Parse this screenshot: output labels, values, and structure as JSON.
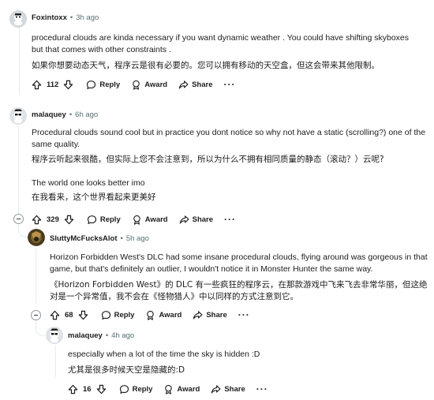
{
  "comments": [
    {
      "username": "Foxintoxx",
      "time": "3h ago",
      "paragraphs": [
        "procedural clouds are kinda necessary if you want dynamic weather . You could have shifting skyboxes but that comes with other constraints .",
        "如果你想要动态天气，程序云是很有必要的。您可以拥有移动的天空盒，但这会带来其他限制。"
      ],
      "score": "112",
      "reply": "Reply",
      "award": "Award",
      "share": "Share"
    },
    {
      "username": "malaquey",
      "time": "6h ago",
      "paragraphs": [
        "Procedural clouds sound cool but in practice you dont notice so why not have a static (scrolling?) one of the same quality.",
        "程序云听起来很酷，但实际上您不会注意到，所以为什么不拥有相同质量的静态（滚动？）云呢?",
        "The world one looks better imo",
        "在我看来，这个世界看起来更美好"
      ],
      "score": "329",
      "reply": "Reply",
      "award": "Award",
      "share": "Share"
    },
    {
      "username": "SluttyMcFucksAlot",
      "time": "5h ago",
      "paragraphs": [
        "Horizon Forbidden West's DLC had some insane procedural clouds, flying around was gorgeous in that game, but that's definitely an outlier, I wouldn't notice it in Monster Hunter the same way.",
        "《Horizon Forbidden West》的 DLC 有一些疯狂的程序云，在那款游戏中飞来飞去非常华丽，但这绝对是一个异常值，我不会在《怪物猎人》中以同样的方式注意到它。"
      ],
      "score": "68",
      "reply": "Reply",
      "award": "Award",
      "share": "Share"
    },
    {
      "username": "malaquey",
      "time": "4h ago",
      "paragraphs": [
        "especially when a lot of the time the sky is hidden :D",
        "尤其是很多时候天空是隐藏的:D"
      ],
      "score": "16",
      "reply": "Reply",
      "award": "Award",
      "share": "Share"
    }
  ],
  "more_options": "···",
  "dot": "•"
}
